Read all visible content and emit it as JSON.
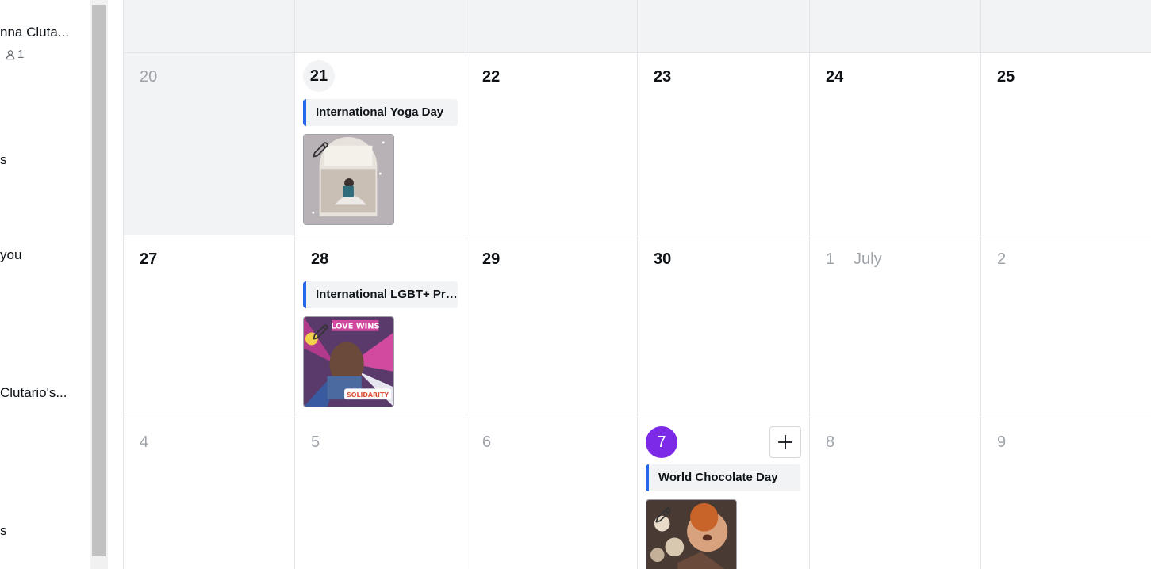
{
  "sidebar": {
    "items": [
      {
        "label": "nna Cluta..."
      },
      {
        "label": "s"
      },
      {
        "label": "you"
      },
      {
        "label": " Clutario's..."
      },
      {
        "label": "s"
      }
    ],
    "member_count": "1",
    "member_icon": "user-icon"
  },
  "calendar": {
    "month_label": "July",
    "days": [
      {
        "day": "20"
      },
      {
        "day": "21"
      },
      {
        "day": "22"
      },
      {
        "day": "23"
      },
      {
        "day": "24"
      },
      {
        "day": "25"
      },
      {
        "day": "27"
      },
      {
        "day": "28"
      },
      {
        "day": "29"
      },
      {
        "day": "30"
      },
      {
        "day": "1"
      },
      {
        "day": "2"
      },
      {
        "day": "4"
      },
      {
        "day": "5"
      },
      {
        "day": "6"
      },
      {
        "day": "7"
      },
      {
        "day": "8"
      },
      {
        "day": "9"
      }
    ],
    "events": [
      {
        "title": "International Yoga Day"
      },
      {
        "title": "International LGBT+ Pride Day"
      },
      {
        "title": "World Chocolate Day"
      }
    ],
    "thumb_badge_texts": [
      "LOVE WINS",
      "SOLIDARITY"
    ],
    "colors": {
      "today": "#7d2ae8",
      "event_accent": "#2567e8",
      "past_bg": "#f2f3f5",
      "scrollbar_thumb": "#c1c1c1"
    }
  }
}
